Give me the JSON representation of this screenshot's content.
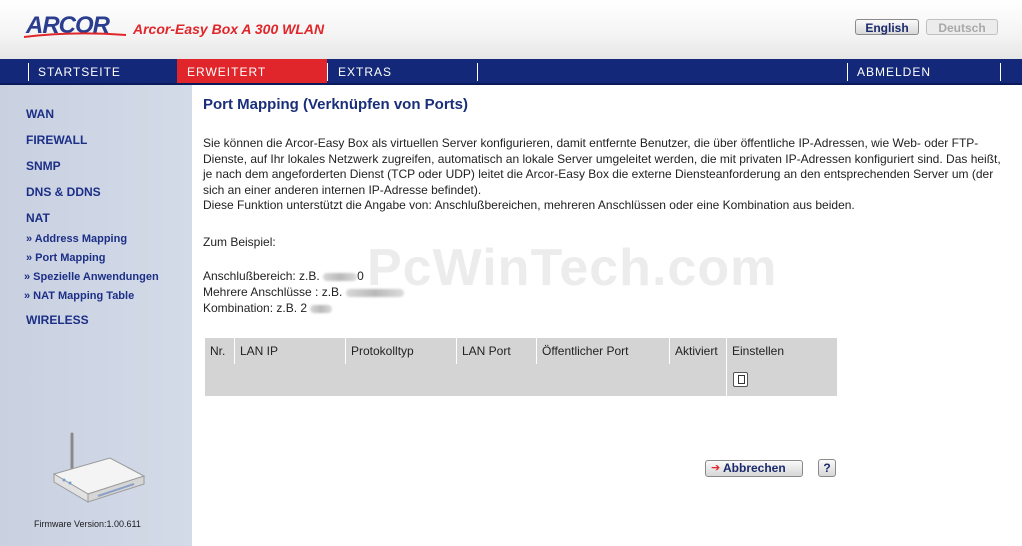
{
  "header": {
    "brand": "ARCOR",
    "product": "Arcor-Easy Box A 300 WLAN",
    "lang_english": "English",
    "lang_deutsch": "Deutsch"
  },
  "nav": {
    "items": [
      "STARTSEITE",
      "ERWEITERT",
      "EXTRAS",
      "ABMELDEN"
    ],
    "active": "ERWEITERT"
  },
  "sidebar": {
    "wan": "WAN",
    "firewall": "FIREWALL",
    "snmp": "SNMP",
    "dns": "DNS & DDNS",
    "nat": "NAT",
    "nat_items": [
      "» Address Mapping",
      "» Port Mapping",
      "» Spezielle Anwendungen",
      "» NAT Mapping Table"
    ],
    "wireless": "WIRELESS",
    "firmware": "Firmware Version:1.00.611"
  },
  "main": {
    "title": "Port Mapping (Verknüpfen von Ports)",
    "description": "Sie können die Arcor-Easy Box als virtuellen Server konfigurieren, damit entfernte Benutzer, die über öffentliche IP-Adressen, wie Web- oder FTP-Dienste, auf Ihr lokales Netzwerk zugreifen, automatisch an lokale Server umgeleitet werden, die mit privaten IP-Adressen konfiguriert sind. Das heißt, je nach dem angeforderten Dienst (TCP oder UDP) leitet die Arcor-Easy Box die externe Diensteanforderung an den entsprechenden Server um (der sich an einer anderen internen IP-Adresse befindet).",
    "description2": "Diese Funktion unterstützt die Angabe von: Anschlußbereichen, mehreren Anschlüssen oder eine Kombination aus beiden.",
    "example_heading": "Zum Beispiel:",
    "example_range": "Anschlußbereich: z.B.",
    "example_range_tail": "0",
    "example_multi": "Mehrere Anschlüsse : z.B.",
    "example_combo": "Kombination: z.B. 2",
    "watermark": "PcWinTech.com"
  },
  "table": {
    "headers": [
      "Nr.",
      "LAN IP",
      "Protokolltyp",
      "LAN Port",
      "Öffentlicher Port",
      "Aktiviert",
      "Einstellen"
    ]
  },
  "buttons": {
    "cancel": "Abbrechen",
    "help": "?"
  },
  "colors": {
    "nav_bg": "#14287a",
    "nav_active": "#e0262a",
    "sidebar_bg": "#cdd4e3",
    "link_blue": "#1c2f86"
  }
}
